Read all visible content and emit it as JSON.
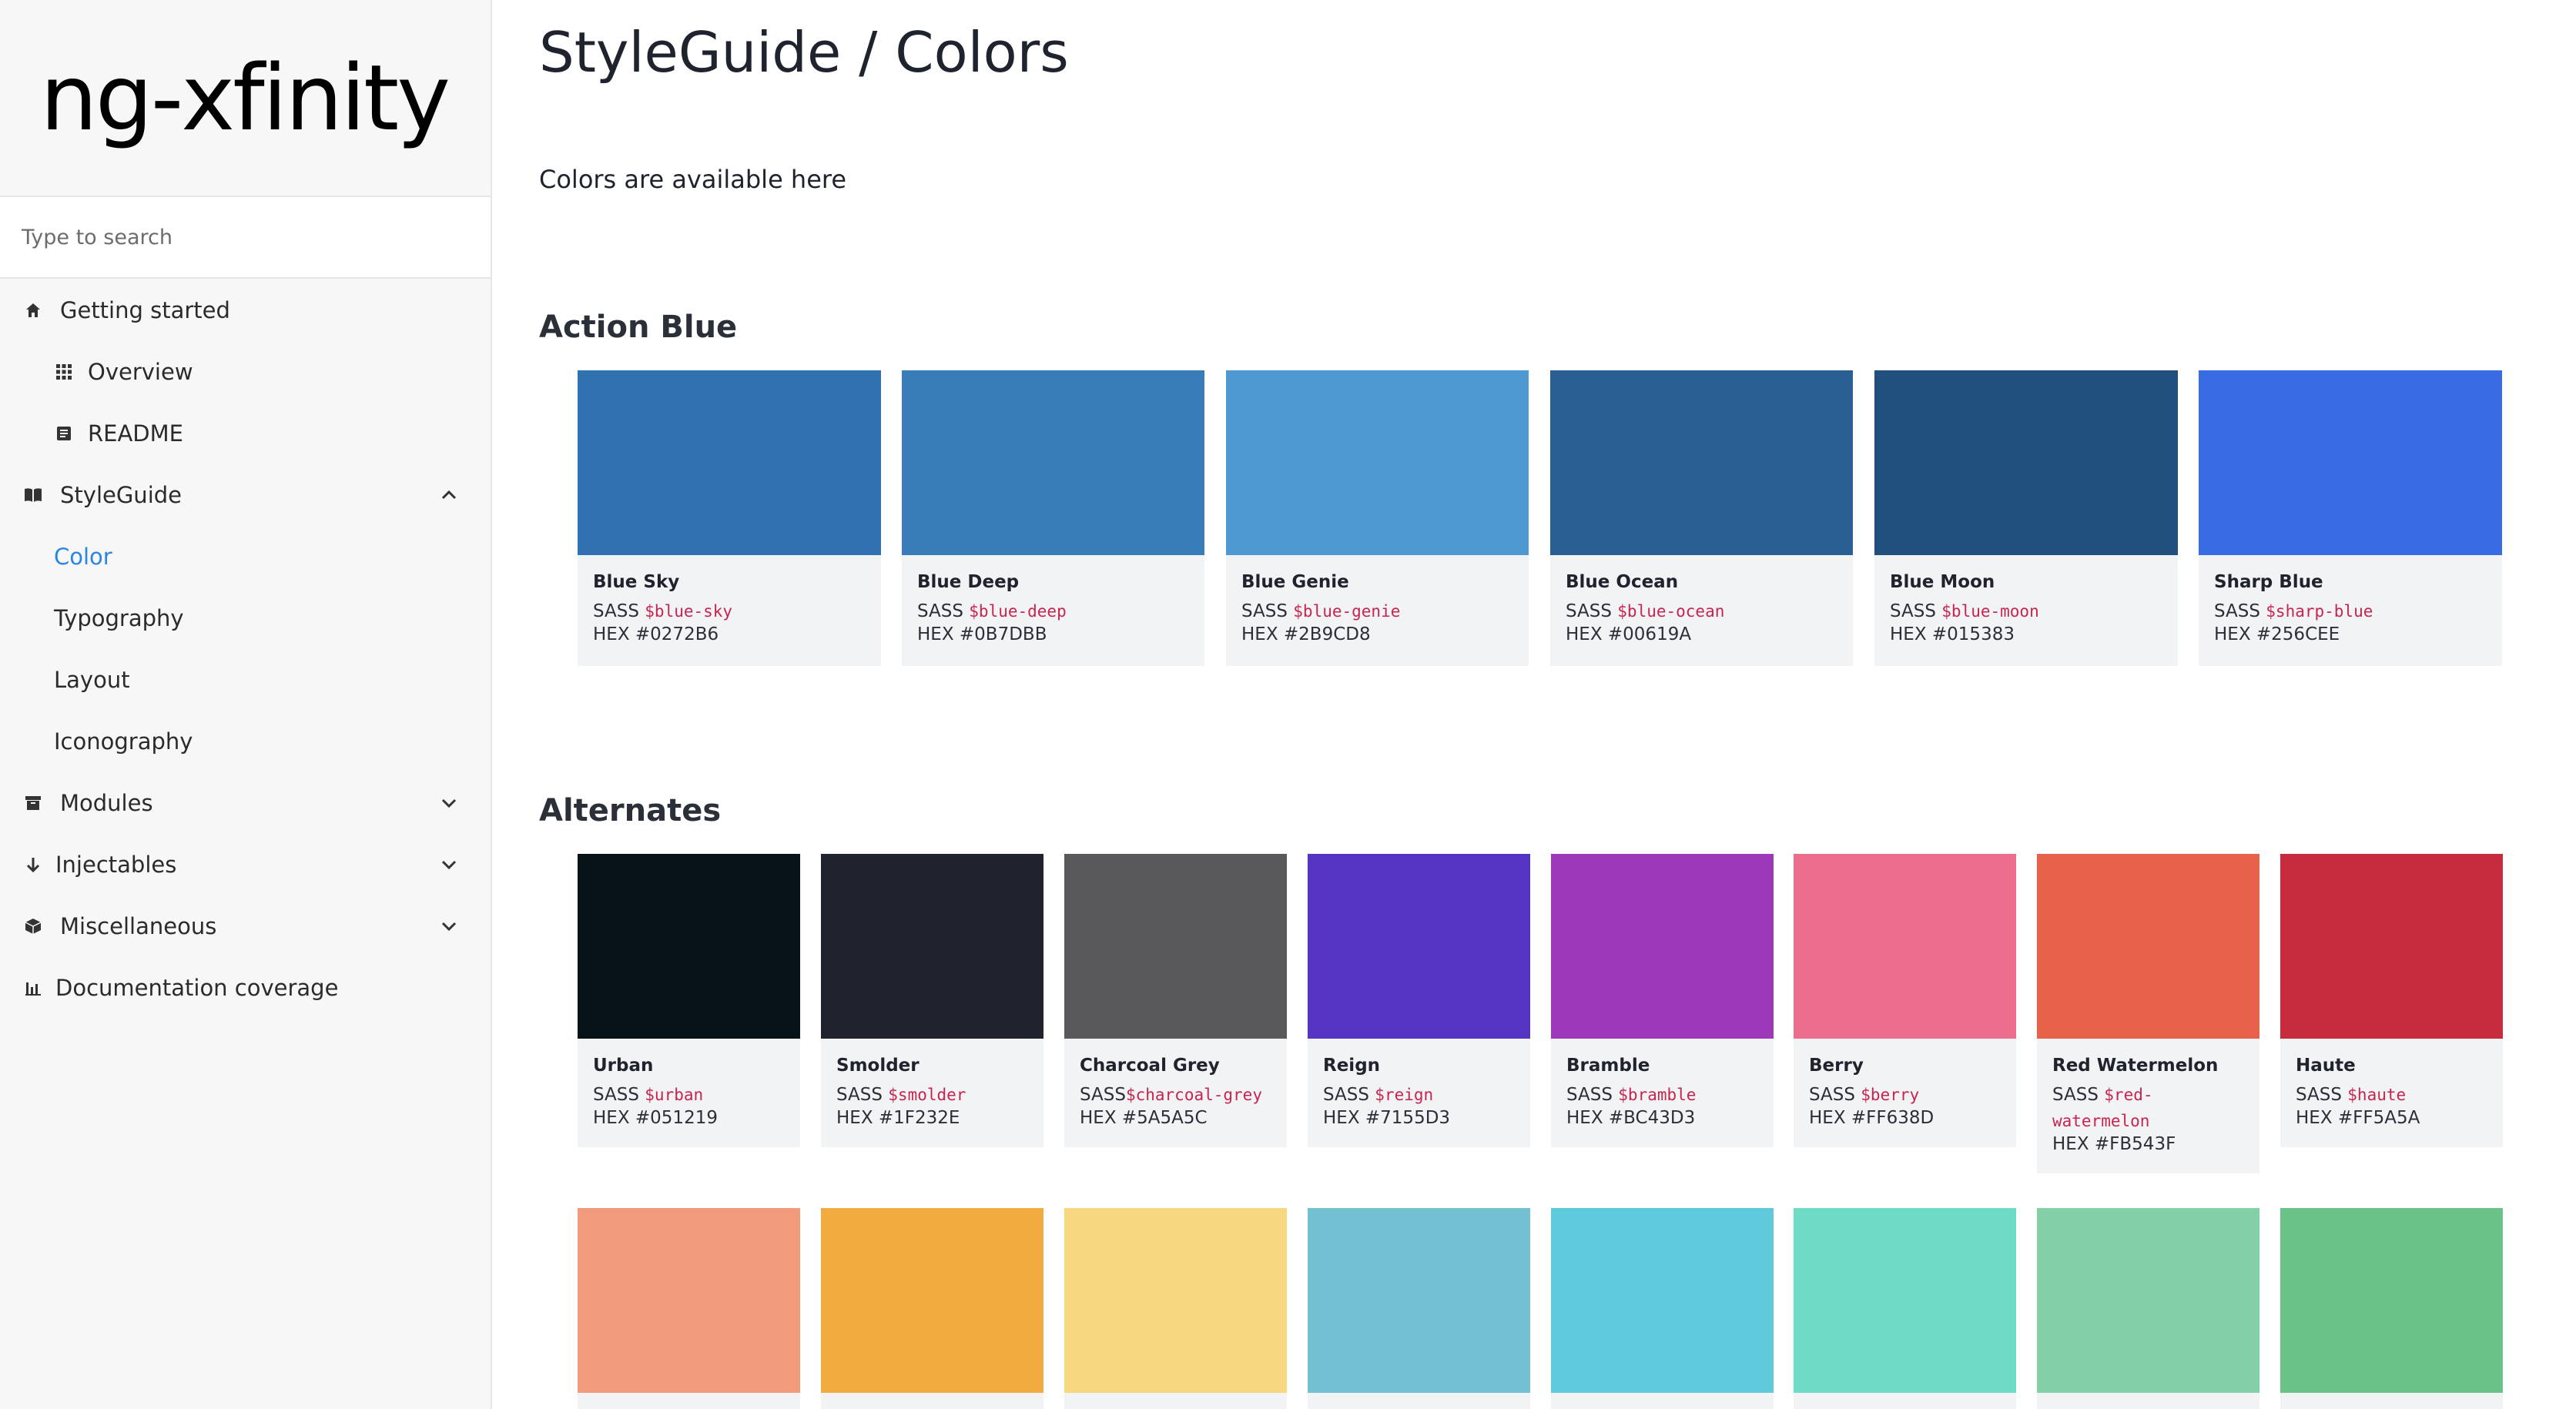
{
  "brand": {
    "logo_text": "ng-xfinity"
  },
  "search": {
    "placeholder": "Type to search"
  },
  "sidebar": {
    "items": [
      {
        "label": "Getting started",
        "icon": "home-icon"
      },
      {
        "label": "Overview",
        "icon": "grid-icon"
      },
      {
        "label": "README",
        "icon": "document-icon"
      },
      {
        "label": "StyleGuide",
        "icon": "book-icon",
        "expanded": true
      },
      {
        "label": "Color",
        "active": true
      },
      {
        "label": "Typography"
      },
      {
        "label": "Layout"
      },
      {
        "label": "Iconography"
      },
      {
        "label": "Modules",
        "icon": "archive-icon",
        "expanded": false
      },
      {
        "label": "Injectables",
        "icon": "arrow-down-icon",
        "expanded": false
      },
      {
        "label": "Miscellaneous",
        "icon": "cube-icon",
        "expanded": false
      },
      {
        "label": "Documentation coverage",
        "icon": "bar-chart-icon"
      }
    ]
  },
  "main": {
    "title": "StyleGuide / Colors",
    "subtitle": "Colors are available here",
    "sections": [
      {
        "title": "Action Blue",
        "colors": [
          {
            "name": "Blue Sky",
            "sass_prefix": "SASS ",
            "sass": "$blue-sky",
            "hex": "HEX #0272B6",
            "swatch": "#3071b0"
          },
          {
            "name": "Blue Deep",
            "sass_prefix": "SASS ",
            "sass": "$blue-deep",
            "hex": "HEX #0B7DBB",
            "swatch": "#387db8"
          },
          {
            "name": "Blue Genie",
            "sass_prefix": "SASS ",
            "sass": "$blue-genie",
            "hex": "HEX #2B9CD8",
            "swatch": "#4f99d3"
          },
          {
            "name": "Blue Ocean",
            "sass_prefix": "SASS ",
            "sass": "$blue-ocean",
            "hex": "HEX #00619A",
            "swatch": "#2a5f94"
          },
          {
            "name": "Blue Moon",
            "sass_prefix": "SASS ",
            "sass": "$blue-moon",
            "hex": "HEX #015383",
            "swatch": "#21507f"
          },
          {
            "name": "Sharp Blue",
            "sass_prefix": "SASS ",
            "sass": "$sharp-blue",
            "hex": "HEX #256CEE",
            "swatch": "#396be4"
          }
        ]
      },
      {
        "title": "Alternates",
        "colors": [
          {
            "name": "Urban",
            "sass_prefix": "SASS ",
            "sass": "$urban",
            "hex": "HEX #051219",
            "swatch": "#071219"
          },
          {
            "name": "Smolder",
            "sass_prefix": "SASS ",
            "sass": "$smolder",
            "hex": "HEX #1F232E",
            "swatch": "#20232e"
          },
          {
            "name": "Charcoal Grey",
            "sass_prefix": "SASS",
            "sass": "$charcoal-grey",
            "hex": "HEX #5A5A5C",
            "swatch": "#59595b"
          },
          {
            "name": "Reign",
            "sass_prefix": "SASS ",
            "sass": "$reign",
            "hex": "HEX #7155D3",
            "swatch": "#5534c3"
          },
          {
            "name": "Bramble",
            "sass_prefix": "SASS ",
            "sass": "$bramble",
            "hex": "HEX #BC43D3",
            "swatch": "#9d38bb"
          },
          {
            "name": "Berry",
            "sass_prefix": "SASS ",
            "sass": "$berry",
            "hex": "HEX #FF638D",
            "swatch": "#ec6d8e"
          },
          {
            "name": "Red Watermelon",
            "sass_prefix": "SASS ",
            "sass": "$red-watermelon",
            "sass_line1": "$red-",
            "sass_line2": "watermelon",
            "hex": "HEX #FB543F",
            "swatch": "#e8614a"
          },
          {
            "name": "Haute",
            "sass_prefix": "SASS ",
            "sass": "$haute",
            "hex": "HEX #FF5A5A",
            "swatch": "#c62b3e"
          }
        ]
      },
      {
        "title": "",
        "colors": [
          {
            "swatch": "#f19b7c"
          },
          {
            "swatch": "#f2ab3e"
          },
          {
            "swatch": "#f7d77f"
          },
          {
            "swatch": "#73c0d2"
          },
          {
            "swatch": "#5ecadc"
          },
          {
            "swatch": "#6ddbc6"
          },
          {
            "swatch": "#83cfa6"
          },
          {
            "swatch": "#6bc289"
          }
        ]
      }
    ]
  }
}
